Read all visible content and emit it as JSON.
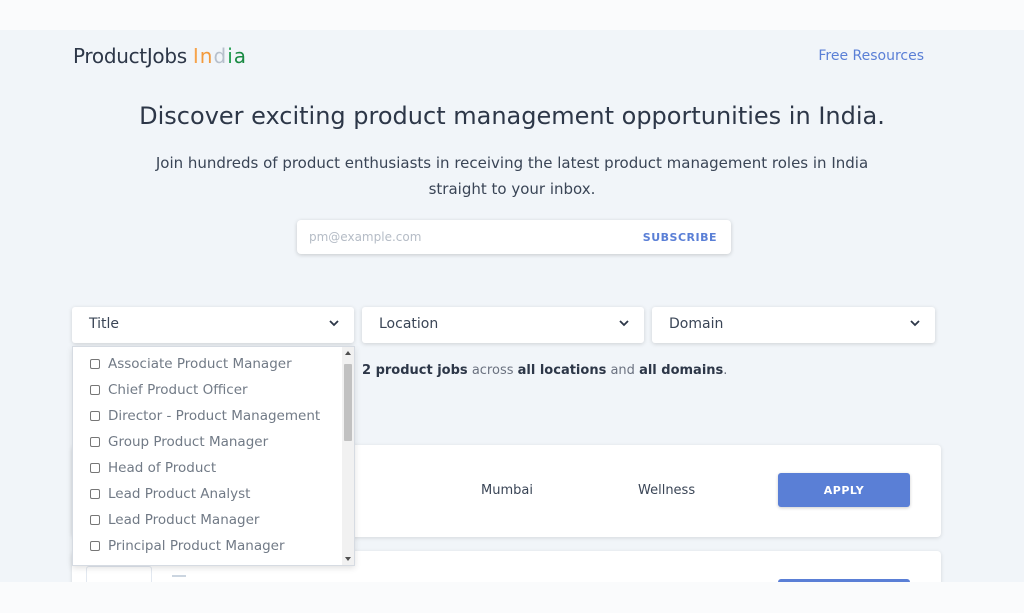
{
  "header": {
    "logo_main": "ProductJobs",
    "logo_india": [
      "I",
      "n",
      "d",
      "i",
      "a"
    ],
    "nav_link": "Free Resources"
  },
  "hero": {
    "title": "Discover exciting product management opportunities in India.",
    "subtitle": "Join hundreds of product enthusiasts in receiving the latest product management roles in India straight to your inbox."
  },
  "subscribe": {
    "placeholder": "pm@example.com",
    "button": "SUBSCRIBE"
  },
  "filters": {
    "title": "Title",
    "location": "Location",
    "domain": "Domain"
  },
  "title_options": [
    "Associate Product Manager",
    "Chief Product Officer",
    "Director - Product Management",
    "Group Product Manager",
    "Head of Product",
    "Lead Product Analyst",
    "Lead Product Manager",
    "Principal Product Manager"
  ],
  "summary": {
    "count": "2 product jobs",
    "across": "across",
    "locations": "all locations",
    "and": "and",
    "domains": "all domains",
    "end": "."
  },
  "jobs": [
    {
      "location": "Mumbai",
      "domain": "Wellness",
      "apply": "APPLY"
    }
  ],
  "colors": {
    "accent": "#5a7fd6",
    "saffron": "#f39a3c",
    "green": "#1f9d4e"
  }
}
